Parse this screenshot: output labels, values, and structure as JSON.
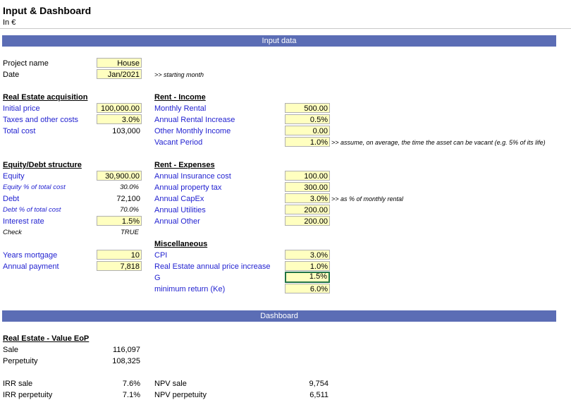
{
  "header": {
    "title": "Input & Dashboard",
    "unit": "In €"
  },
  "bands": {
    "input": "Input data",
    "dashboard": "Dashboard"
  },
  "project": {
    "name_label": "Project name",
    "name_value": "House",
    "date_label": "Date",
    "date_value": "Jan/2021",
    "date_note": ">> starting month"
  },
  "acquisition": {
    "title": "Real Estate acquisition",
    "initial_price_label": "Initial price",
    "initial_price_value": "100,000.00",
    "taxes_label": "Taxes and other costs",
    "taxes_value": "3.0%",
    "total_label": "Total cost",
    "total_value": "103,000"
  },
  "equity": {
    "title": "Equity/Debt structure",
    "equity_label": "Equity",
    "equity_value": "30,900.00",
    "equity_pct_label": "Equity % of total cost",
    "equity_pct_value": "30.0%",
    "debt_label": "Debt",
    "debt_value": "72,100",
    "debt_pct_label": "Debt % of total cost",
    "debt_pct_value": "70.0%",
    "interest_label": "Interest rate",
    "interest_value": "1.5%",
    "check_label": "Check",
    "check_value": "TRUE",
    "years_label": "Years mortgage",
    "years_value": "10",
    "payment_label": "Annual payment",
    "payment_value": "7,818"
  },
  "income": {
    "title": "Rent - Income",
    "monthly_label": "Monthly Rental",
    "monthly_value": "500.00",
    "increase_label": "Annual Rental Increase",
    "increase_value": "0.5%",
    "other_label": "Other Monthly Income",
    "other_value": "0.00",
    "vacant_label": "Vacant Period",
    "vacant_value": "1.0%",
    "vacant_note": ">> assume, on average, the time the asset can be vacant (e.g. 5% of its life)"
  },
  "expenses": {
    "title": "Rent - Expenses",
    "insurance_label": "Annual Insurance cost",
    "insurance_value": "100.00",
    "tax_label": "Annual property tax",
    "tax_value": "300.00",
    "capex_label": "Annual CapEx",
    "capex_value": "3.0%",
    "capex_note": ">> as % of monthly rental",
    "utilities_label": "Annual Utilities",
    "utilities_value": "200.00",
    "other_label": "Annual Other",
    "other_value": "200.00"
  },
  "misc": {
    "title": "Miscellaneous",
    "cpi_label": "CPI",
    "cpi_value": "3.0%",
    "price_increase_label": "Real Estate annual price increase",
    "price_increase_value": "1.0%",
    "g_label": "G",
    "g_value": "1.5%",
    "ke_label": "minimum return (Ke)",
    "ke_value": "6.0%"
  },
  "dashboard": {
    "value_title": "Real Estate - Value EoP",
    "sale_label": "Sale",
    "sale_value": "116,097",
    "perp_label": "Perpetuity",
    "perp_value": "108,325",
    "irr_sale_label": "IRR sale",
    "irr_sale_value": "7.6%",
    "irr_perp_label": "IRR perpetuity",
    "irr_perp_value": "7.1%",
    "npv_sale_label": "NPV sale",
    "npv_sale_value": "9,754",
    "npv_perp_label": "NPV perpetuity",
    "npv_perp_value": "6,511"
  },
  "colors": {
    "band": "#5b6db5",
    "input_cell": "#ffffc0",
    "label_blue": "#1f1fd0",
    "selected_border": "#217346"
  }
}
